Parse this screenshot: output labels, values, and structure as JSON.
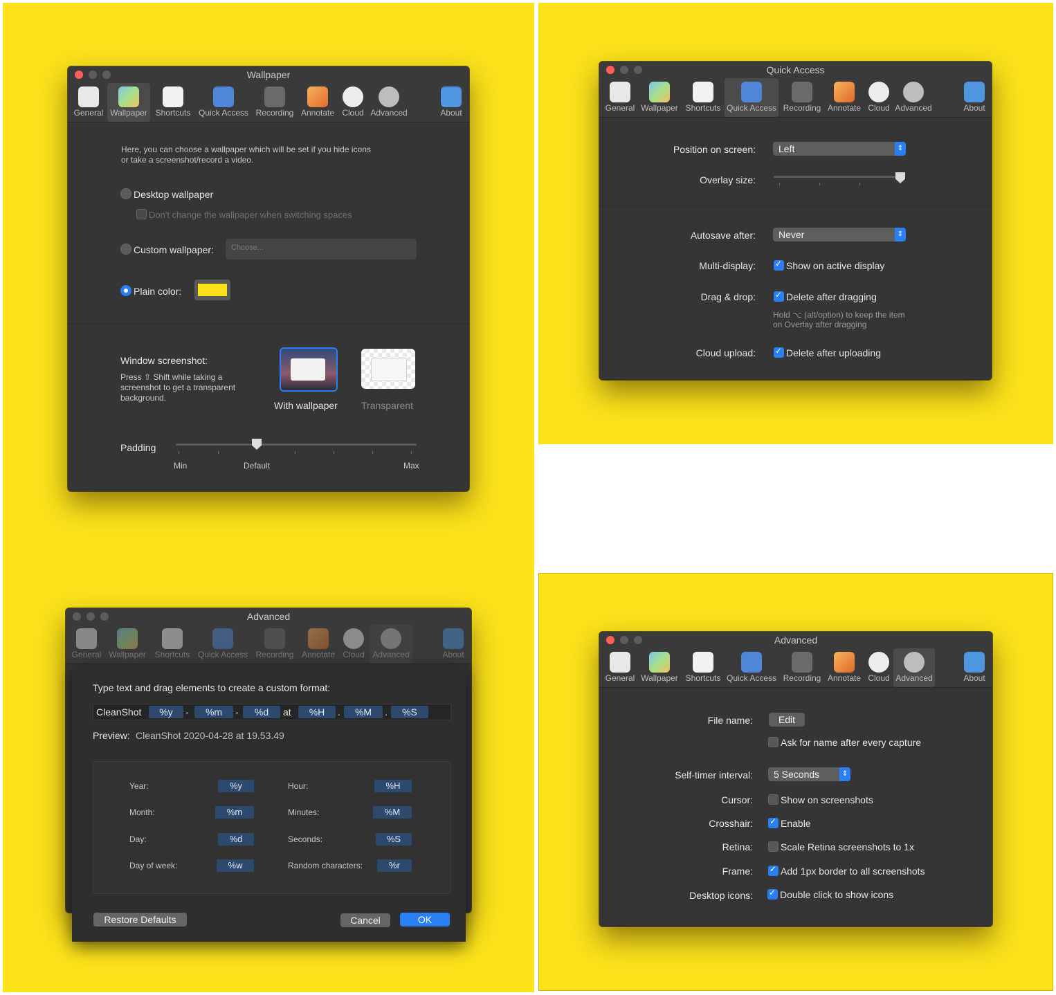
{
  "colors": {
    "background_yellow": "#fbe21b",
    "accent": "#2a7ff5",
    "window": "#353535",
    "plain_color_swatch": "#fbe21b"
  },
  "toolbar_items": [
    {
      "label": "General",
      "icon": "general-icon"
    },
    {
      "label": "Wallpaper",
      "icon": "wallpaper-icon"
    },
    {
      "label": "Shortcuts",
      "icon": "shortcuts-icon"
    },
    {
      "label": "Quick Access",
      "icon": "quick-access-icon"
    },
    {
      "label": "Recording",
      "icon": "recording-icon"
    },
    {
      "label": "Annotate",
      "icon": "annotate-icon"
    },
    {
      "label": "Cloud",
      "icon": "cloud-icon"
    },
    {
      "label": "Advanced",
      "icon": "gear-icon"
    },
    {
      "label": "About",
      "icon": "about-icon"
    }
  ],
  "wallpaper": {
    "title": "Wallpaper",
    "intro_line1": "Here, you can choose a wallpaper which will be set if you hide icons",
    "intro_line2": "or take a screenshot/record a video.",
    "desktop_wallpaper": "Desktop wallpaper",
    "dont_change": "Don't change the wallpaper when switching spaces",
    "custom_wallpaper": "Custom wallpaper:",
    "choose_placeholder": "Choose...",
    "plain_color": "Plain color:",
    "window_screenshot": "Window screenshot:",
    "press_line1": "Press ⇧ Shift while taking a",
    "press_line2": "screenshot to get a transparent",
    "press_line3": "background.",
    "with_wallpaper": "With wallpaper",
    "transparent": "Transparent",
    "padding": "Padding",
    "min": "Min",
    "default": "Default",
    "max": "Max"
  },
  "quick_access": {
    "title": "Quick Access",
    "position_label": "Position on screen:",
    "position_value": "Left",
    "overlay_label": "Overlay size:",
    "overlay_level": 1.0,
    "autosave_label": "Autosave after:",
    "autosave_value": "Never",
    "multi_label": "Multi-display:",
    "multi_value": "Show on active display",
    "drag_label": "Drag & drop:",
    "drag_value": "Delete after dragging",
    "drag_hint1": "Hold ⌥ (alt/option) to keep the item",
    "drag_hint2": "on Overlay after dragging",
    "cloud_label": "Cloud upload:",
    "cloud_value": "Delete after uploading"
  },
  "format_dialog": {
    "title": "Advanced",
    "instructions": "Type text and drag elements to create a custom format:",
    "format_tokens": [
      "CleanShot",
      "%y",
      "-",
      "%m",
      "-",
      "%d",
      "at",
      "%H",
      ".",
      "%M",
      ".",
      "%S"
    ],
    "preview_label": "Preview:",
    "preview_value": "CleanShot 2020-04-28 at 19.53.49",
    "elements_left": [
      {
        "label": "Year:",
        "token": "%y"
      },
      {
        "label": "Month:",
        "token": "%m"
      },
      {
        "label": "Day:",
        "token": "%d"
      },
      {
        "label": "Day of week:",
        "token": "%w"
      }
    ],
    "elements_right": [
      {
        "label": "Hour:",
        "token": "%H"
      },
      {
        "label": "Minutes:",
        "token": "%M"
      },
      {
        "label": "Seconds:",
        "token": "%S"
      },
      {
        "label": "Random characters:",
        "token": "%r"
      }
    ],
    "restore": "Restore Defaults",
    "cancel": "Cancel",
    "ok": "OK"
  },
  "advanced": {
    "title": "Advanced",
    "file_name_label": "File name:",
    "edit": "Edit",
    "ask_name": "Ask for name after every capture",
    "timer_label": "Self-timer interval:",
    "timer_value": "5 Seconds",
    "cursor_label": "Cursor:",
    "cursor_value": "Show on screenshots",
    "crosshair_label": "Crosshair:",
    "crosshair_value": "Enable",
    "retina_label": "Retina:",
    "retina_value": "Scale Retina screenshots to 1x",
    "frame_label": "Frame:",
    "frame_value": "Add 1px border to all screenshots",
    "desktop_label": "Desktop icons:",
    "desktop_value": "Double click to show icons"
  }
}
